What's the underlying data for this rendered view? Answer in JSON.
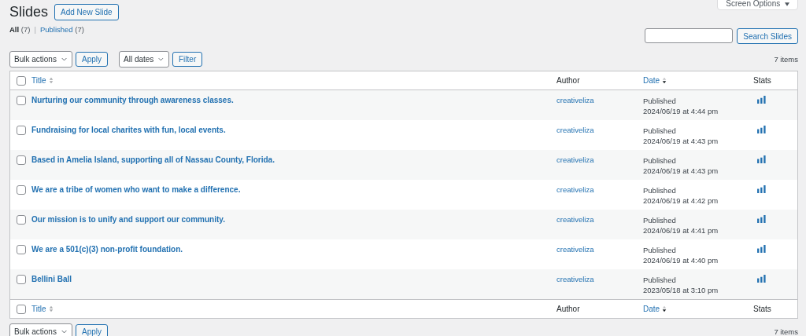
{
  "page_title": "Slides",
  "add_button": "Add New Slide",
  "screen_options": "Screen Options",
  "views": [
    {
      "label": "All",
      "count": "(7)",
      "selected": true,
      "separator": "|"
    },
    {
      "label": "Published",
      "count": "(7)",
      "selected": false
    }
  ],
  "search": {
    "button": "Search Slides"
  },
  "top_bar": {
    "bulk": "Bulk actions",
    "apply": "Apply",
    "dates": "All dates",
    "filter": "Filter",
    "count": "7 items"
  },
  "columns": [
    {
      "label": "Title",
      "kind": "sortable",
      "sorted": false
    },
    {
      "label": "Author",
      "kind": "plain"
    },
    {
      "label": "Date",
      "kind": "sortable",
      "sorted": true
    },
    {
      "label": "Stats",
      "kind": "plain"
    }
  ],
  "footer_columns": [
    {
      "label": "Title",
      "kind": "sortable",
      "sorted": false
    },
    {
      "label": "Author",
      "kind": "plain"
    },
    {
      "label": "Date",
      "kind": "sortable",
      "sorted": true
    },
    {
      "label": "Stats",
      "kind": "plain"
    }
  ],
  "header_checked": false,
  "footer_checked": false,
  "rows": [
    {
      "title": "Nurturing our community through awareness classes.",
      "author": "creativeliza",
      "status": "Published",
      "date": "2024/06/19 at 4:44 pm",
      "checked": false
    },
    {
      "title": "Fundraising for local charites with fun, local events.",
      "author": "creativeliza",
      "status": "Published",
      "date": "2024/06/19 at 4:43 pm",
      "checked": false
    },
    {
      "title": "Based in Amelia Island, supporting all of Nassau County, Florida.",
      "author": "creativeliza",
      "status": "Published",
      "date": "2024/06/19 at 4:43 pm",
      "checked": false
    },
    {
      "title": "We are a tribe of women who want to make a difference.",
      "author": "creativeliza",
      "status": "Published",
      "date": "2024/06/19 at 4:42 pm",
      "checked": false
    },
    {
      "title": "Our mission is to unify and support our community.",
      "author": "creativeliza",
      "status": "Published",
      "date": "2024/06/19 at 4:41 pm",
      "checked": false
    },
    {
      "title": "We are a 501(c)(3) non-profit foundation.",
      "author": "creativeliza",
      "status": "Published",
      "date": "2024/06/19 at 4:40 pm",
      "checked": false
    },
    {
      "title": "Bellini Ball",
      "author": "creativeliza",
      "status": "Published",
      "date": "2023/05/18 at 3:10 pm",
      "checked": false
    }
  ],
  "bottom_bar": {
    "bulk": "Bulk actions",
    "apply": "Apply",
    "count": "7 items"
  }
}
